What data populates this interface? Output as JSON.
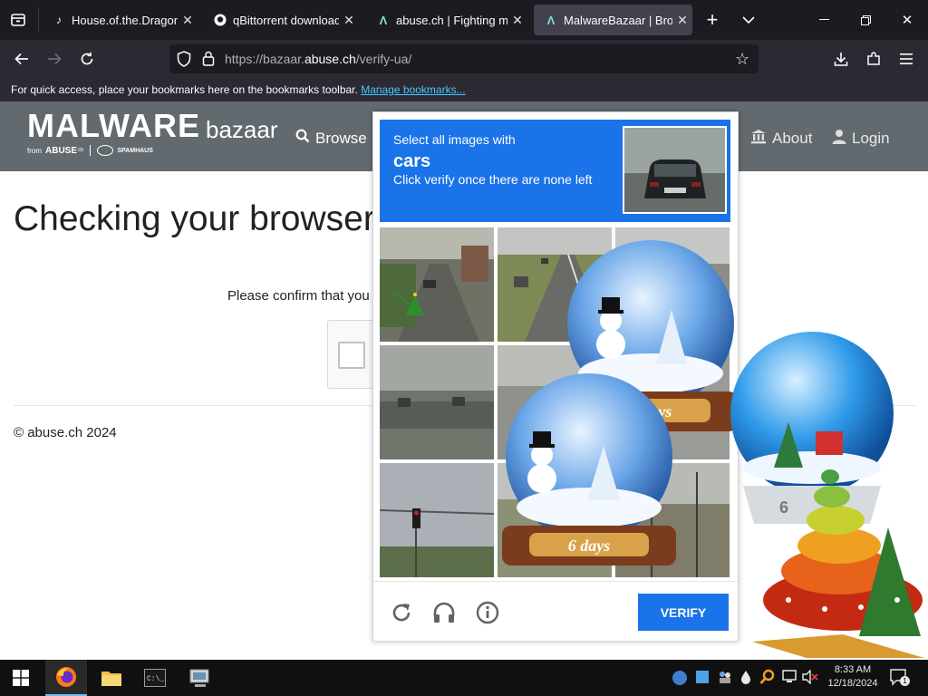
{
  "browser": {
    "tabs": [
      {
        "title": "House.of.the.Dragon.S",
        "favicon": "music-note-icon"
      },
      {
        "title": "qBittorrent download l",
        "favicon": "github-icon"
      },
      {
        "title": "abuse.ch | Fighting ma",
        "favicon": "abuse-ch-icon"
      },
      {
        "title": "MalwareBazaar | Brows",
        "favicon": "abuse-ch-icon",
        "active": true
      }
    ],
    "url": {
      "prefix": "https://bazaar.",
      "domain": "abuse.ch",
      "path": "/verify-ua/"
    },
    "bookmarks": {
      "message": "For quick access, place your bookmarks here on the bookmarks toolbar.",
      "manage_link": "Manage bookmarks..."
    }
  },
  "site": {
    "logo": {
      "main": "MALWARE",
      "secondary": "bazaar",
      "from": "from",
      "abuse": "ABUSE",
      "abuse_sup": "ch",
      "spamhaus": "SPAMHAUS"
    },
    "nav": {
      "browse": "Browse",
      "about": "About",
      "login": "Login"
    },
    "heading": "Checking your browser",
    "confirm_text": "Please confirm that you",
    "copyright": "© abuse.ch 2024"
  },
  "captcha": {
    "instruction": "Select all images with",
    "target": "cars",
    "hint": "Click verify once there are none left",
    "verify_label": "VERIFY",
    "footer_icons": [
      "reload-icon",
      "headphones-icon",
      "info-icon"
    ]
  },
  "overlays": {
    "snowglobe_label_1": "6 days",
    "snowglobe_label_2": "6 days",
    "snowglobe_label_3": "6"
  },
  "taskbar": {
    "time": "8:33 AM",
    "date": "12/18/2024",
    "notification_count": "1"
  },
  "colors": {
    "accent": "#1a73e8",
    "header": "#626a6f",
    "link": "#45c8ff"
  }
}
